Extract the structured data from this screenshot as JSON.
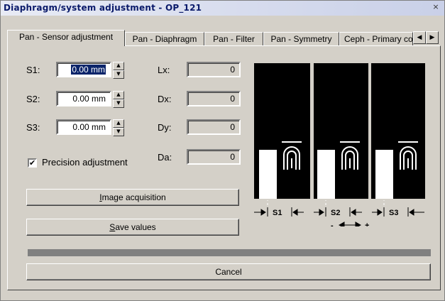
{
  "window": {
    "title": "Diaphragm/system adjustment - OP_121",
    "close_glyph": "×"
  },
  "tabs": [
    {
      "label": "Pan - Sensor adjustment"
    },
    {
      "label": "Pan - Diaphragm"
    },
    {
      "label": "Pan - Filter"
    },
    {
      "label": "Pan - Symmetry"
    },
    {
      "label": "Ceph - Primary collimator"
    }
  ],
  "sensors": [
    {
      "label": "S1:",
      "value": "0.00 mm"
    },
    {
      "label": "S2:",
      "value": "0.00 mm"
    },
    {
      "label": "S3:",
      "value": "0.00 mm"
    }
  ],
  "readouts": [
    {
      "label": "Lx:",
      "value": "0"
    },
    {
      "label": "Dx:",
      "value": "0"
    },
    {
      "label": "Dy:",
      "value": "0"
    },
    {
      "label": "Da:",
      "value": "0"
    }
  ],
  "precision": {
    "label": "Precision adjustment",
    "checked": true,
    "check_glyph": "✔"
  },
  "buttons": {
    "image_acquisition": {
      "prefix": "",
      "accel": "I",
      "rest": "mage acquisition"
    },
    "save_values": {
      "prefix": "",
      "accel": "S",
      "rest": "ave values"
    },
    "cancel": "Cancel"
  },
  "diagram": {
    "sections": [
      "S1",
      "S2",
      "S3"
    ],
    "minus": "-",
    "plus": "+"
  },
  "progress": {
    "value": 1.0,
    "color": "#808080"
  }
}
